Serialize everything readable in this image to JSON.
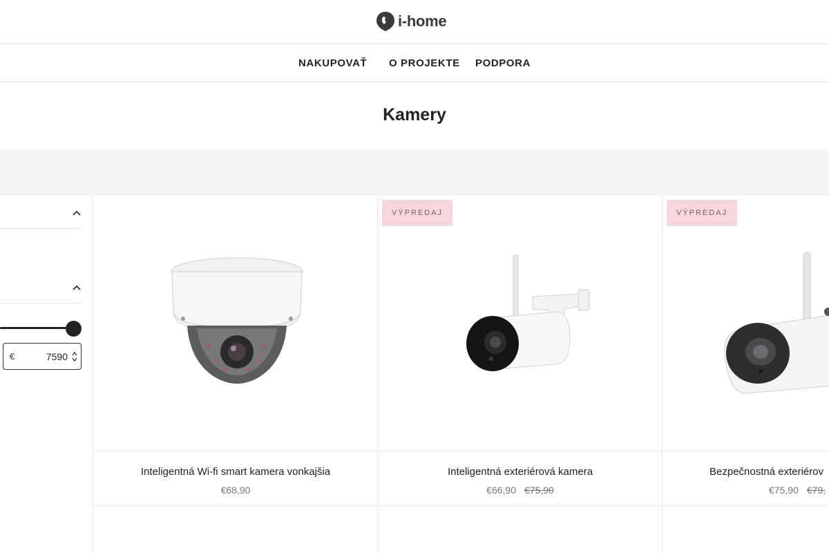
{
  "brand": {
    "name": "i-home"
  },
  "nav": {
    "items": [
      {
        "label": "NAKUPOVAŤ"
      },
      {
        "label": "O PROJEKTE"
      },
      {
        "label": "PODPORA"
      }
    ]
  },
  "page": {
    "title": "Kamery"
  },
  "filters": {
    "price": {
      "currency": "€",
      "max_value": "7590",
      "slider_max_fraction": 1.0
    }
  },
  "products": [
    {
      "title": "Inteligentná Wi-fi smart kamera vonkajšia",
      "price": "€68,90",
      "old_price": "",
      "badge": ""
    },
    {
      "title": "Inteligentná exteriérová kamera",
      "price": "€66,90",
      "old_price": "€75,90",
      "badge": "VÝPREDAJ"
    },
    {
      "title": "Bezpečnostná exteriérov",
      "price": "€75,90",
      "old_price": "€79,",
      "badge": "VÝPREDAJ"
    }
  ],
  "icons": {
    "logo": "location-pin-icon",
    "collapse": "chevron-up-icon",
    "stepper": "number-spinner-icon"
  },
  "colors": {
    "badge_bg": "#f8d6de",
    "text": "#222222",
    "muted_price": "#777777"
  }
}
